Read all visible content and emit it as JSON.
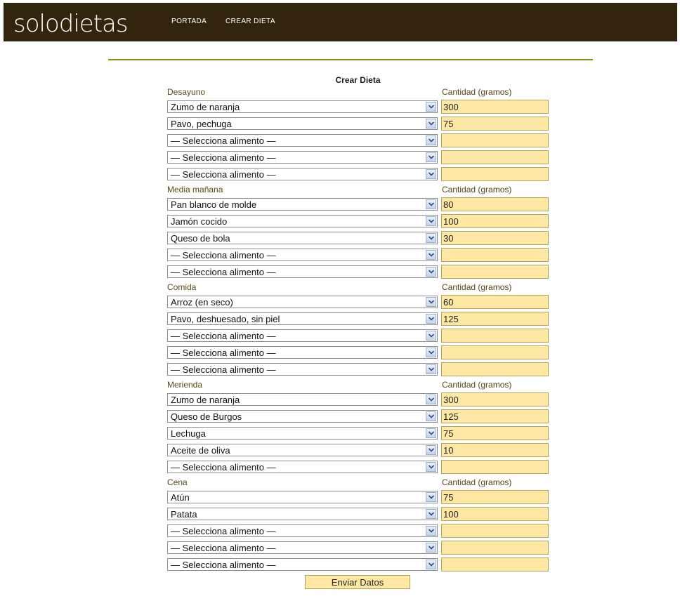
{
  "site": {
    "logo": "solodietas"
  },
  "nav": [
    {
      "label": "PORTADA"
    },
    {
      "label": "CREAR DIETA"
    }
  ],
  "form": {
    "title": "Crear Dieta",
    "quantity_header": "Cantidad (gramos)",
    "placeholder_option": "— Selecciona alimento —",
    "submit_label": "Enviar Datos",
    "meals": [
      {
        "name": "Desayuno",
        "rows": [
          {
            "food": "Zumo de naranja",
            "qty": "300"
          },
          {
            "food": "Pavo, pechuga",
            "qty": "75"
          },
          {
            "food": "— Selecciona alimento —",
            "qty": ""
          },
          {
            "food": "— Selecciona alimento —",
            "qty": ""
          },
          {
            "food": "— Selecciona alimento —",
            "qty": ""
          }
        ]
      },
      {
        "name": "Media mañana",
        "rows": [
          {
            "food": "Pan blanco de molde",
            "qty": "80"
          },
          {
            "food": "Jamón cocido",
            "qty": "100"
          },
          {
            "food": "Queso de bola",
            "qty": "30"
          },
          {
            "food": "— Selecciona alimento —",
            "qty": ""
          },
          {
            "food": "— Selecciona alimento —",
            "qty": ""
          }
        ]
      },
      {
        "name": "Comida",
        "rows": [
          {
            "food": "Arroz (en seco)",
            "qty": "60"
          },
          {
            "food": "Pavo, deshuesado, sin piel",
            "qty": "125"
          },
          {
            "food": "— Selecciona alimento —",
            "qty": ""
          },
          {
            "food": "— Selecciona alimento —",
            "qty": ""
          },
          {
            "food": "— Selecciona alimento —",
            "qty": ""
          }
        ]
      },
      {
        "name": "Merienda",
        "rows": [
          {
            "food": "Zumo de naranja",
            "qty": "300"
          },
          {
            "food": "Queso de Burgos",
            "qty": "125"
          },
          {
            "food": "Lechuga",
            "qty": "75"
          },
          {
            "food": "Aceite de oliva",
            "qty": "10"
          },
          {
            "food": "— Selecciona alimento —",
            "qty": ""
          }
        ]
      },
      {
        "name": "Cena",
        "rows": [
          {
            "food": "Atún",
            "qty": "75"
          },
          {
            "food": "Patata",
            "qty": "100"
          },
          {
            "food": "— Selecciona alimento —",
            "qty": ""
          },
          {
            "food": "— Selecciona alimento —",
            "qty": ""
          },
          {
            "food": "— Selecciona alimento —",
            "qty": ""
          }
        ]
      }
    ]
  },
  "colors": {
    "header_bg": "#33250d",
    "divider": "#8a8a10",
    "input_bg": "#ffe8a4",
    "label_text": "#5a4a14"
  }
}
